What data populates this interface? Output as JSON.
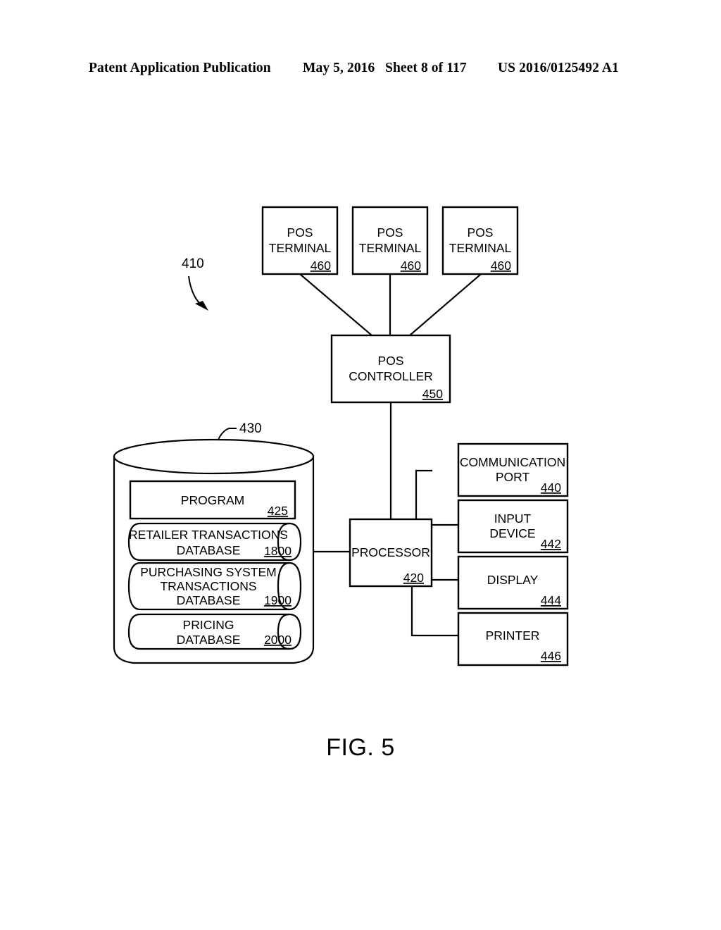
{
  "header": {
    "publication": "Patent Application Publication",
    "date": "May 5, 2016",
    "sheet": "Sheet 8 of 117",
    "number": "US 2016/0125492 A1"
  },
  "figure": {
    "caption": "FIG. 5",
    "system_ref": "410",
    "storage_ref": "430"
  },
  "terminals": [
    {
      "line1": "POS",
      "line2": "TERMINAL",
      "ref": "460"
    },
    {
      "line1": "POS",
      "line2": "TERMINAL",
      "ref": "460"
    },
    {
      "line1": "POS",
      "line2": "TERMINAL",
      "ref": "460"
    }
  ],
  "controller": {
    "line1": "POS",
    "line2": "CONTROLLER",
    "ref": "450"
  },
  "processor": {
    "label": "PROCESSOR",
    "ref": "420"
  },
  "storage": {
    "program": {
      "label": "PROGRAM",
      "ref": "425"
    },
    "databases": [
      {
        "line1": "RETAILER TRANSACTIONS",
        "line2": "DATABASE",
        "line3": "",
        "ref": "1800"
      },
      {
        "line1": "PURCHASING SYSTEM",
        "line2": "TRANSACTIONS",
        "line3": "DATABASE",
        "ref": "1900"
      },
      {
        "line1": "PRICING",
        "line2": "DATABASE",
        "line3": "",
        "ref": "2000"
      }
    ]
  },
  "peripherals": [
    {
      "line1": "COMMUNICATION",
      "line2": "PORT",
      "ref": "440"
    },
    {
      "line1": "INPUT",
      "line2": "DEVICE",
      "ref": "442"
    },
    {
      "line1": "DISPLAY",
      "line2": "",
      "ref": "444"
    },
    {
      "line1": "PRINTER",
      "line2": "",
      "ref": "446"
    }
  ]
}
